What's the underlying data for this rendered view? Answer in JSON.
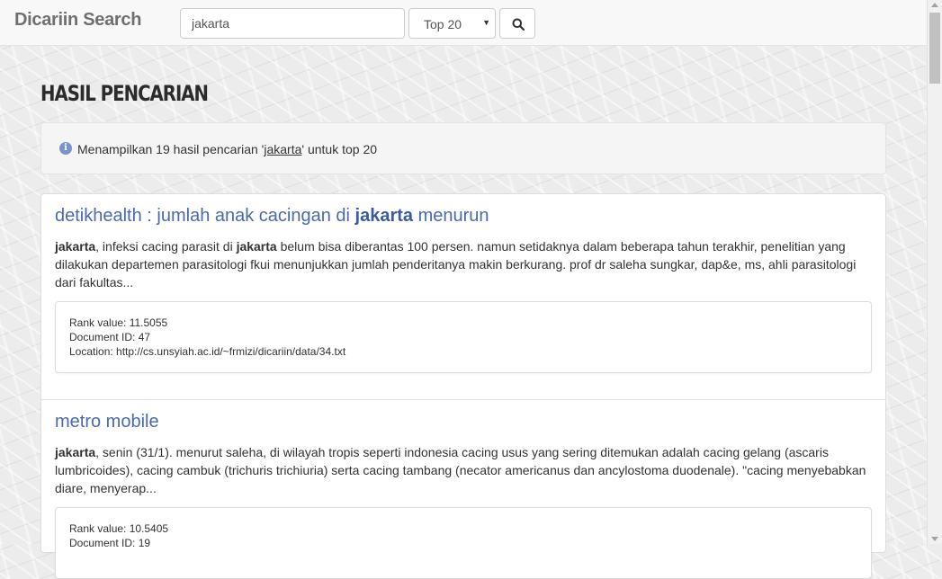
{
  "navbar": {
    "brand": "Dicariin Search",
    "search_value": "jakarta",
    "select_value": "Top 20",
    "search_icon": "search-icon"
  },
  "main": {
    "title": "HASIL PENCARIAN",
    "info": {
      "icon": "info-icon",
      "prefix": "Menampilkan 19 hasil pencarian '",
      "query": "jakarta",
      "suffix": "' untuk top 20"
    },
    "results": [
      {
        "title_pre": "detikhealth : jumlah anak cacingan di ",
        "title_bold": "jakarta",
        "title_post": " menurun",
        "snippet_bold": "jakarta",
        "snippet_1": ", infeksi cacing parasit di ",
        "snippet_bold2": "jakarta",
        "snippet_2": " belum bisa diberantas 100 persen. namun setidaknya dalam beberapa tahun terakhir, penelitian yang dilakukan departemen parasitologi fkui menunjukkan jumlah penderitanya makin berkurang. prof dr saleha sungkar, dap&e, ms, ahli parasitologi dari fakultas...",
        "rank": "Rank value: 11.5055",
        "doc_id": "Document ID: 47",
        "location": "Location: http://cs.unsyiah.ac.id/~frmizi/dicariin/data/34.txt"
      },
      {
        "title_pre": "metro mobile",
        "title_bold": "",
        "title_post": "",
        "snippet_bold": "jakarta",
        "snippet_1": ", senin (31/1). menurut saleha, di wilayah tropis seperti indonesia cacing usus yang sering ditemukan adalah cacing gelang (ascaris lumbricoides), cacing cambuk (trichuris trichiuria) serta cacing tambang (necator americanus dan ancylostoma duodenale). \"cacing menyebabkan diare, menyerap...",
        "snippet_bold2": "",
        "snippet_2": "",
        "rank": "Rank value: 10.5405",
        "doc_id": "Document ID: 19",
        "location": ""
      }
    ]
  }
}
